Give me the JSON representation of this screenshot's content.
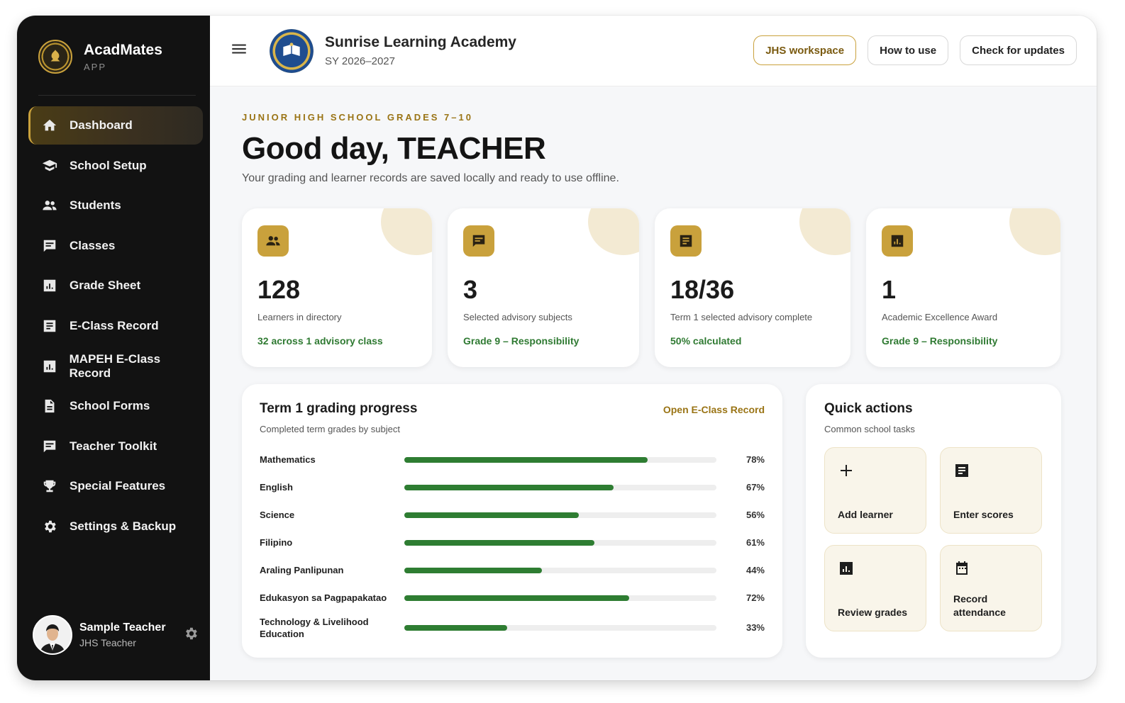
{
  "brand": {
    "name": "AcadMates",
    "sub": "APP"
  },
  "nav": [
    {
      "label": "Dashboard",
      "icon": "home-icon",
      "active": true
    },
    {
      "label": "School Setup",
      "icon": "school-icon"
    },
    {
      "label": "Students",
      "icon": "people-icon"
    },
    {
      "label": "Classes",
      "icon": "chat-icon"
    },
    {
      "label": "Grade Sheet",
      "icon": "chart-icon"
    },
    {
      "label": "E-Class Record",
      "icon": "record-icon"
    },
    {
      "label": "MAPEH E-Class Record",
      "icon": "chart-icon"
    },
    {
      "label": "School Forms",
      "icon": "document-icon"
    },
    {
      "label": "Teacher Toolkit",
      "icon": "chat-icon"
    },
    {
      "label": "Special Features",
      "icon": "trophy-icon"
    },
    {
      "label": "Settings & Backup",
      "icon": "gear-icon"
    }
  ],
  "user": {
    "name": "Sample Teacher",
    "role": "JHS Teacher"
  },
  "header": {
    "school_name": "Sunrise Learning Academy",
    "school_year": "SY 2026–2027",
    "buttons": {
      "workspace": "JHS workspace",
      "how_to": "How to use",
      "updates": "Check for updates"
    }
  },
  "hero": {
    "eyebrow": "JUNIOR HIGH SCHOOL GRADES 7–10",
    "greeting": "Good day, TEACHER",
    "subtitle": "Your grading and learner records are saved locally and ready to use offline."
  },
  "cards": [
    {
      "value": "128",
      "label": "Learners in directory",
      "note": "32 across 1 advisory class",
      "icon": "people-icon"
    },
    {
      "value": "3",
      "label": "Selected advisory subjects",
      "note": "Grade 9 – Responsibility",
      "icon": "chat-icon"
    },
    {
      "value": "18/36",
      "label": "Term 1 selected advisory complete",
      "note": "50% calculated",
      "icon": "record-icon"
    },
    {
      "value": "1",
      "label": "Academic Excellence Award",
      "note": "Grade 9 – Responsibility",
      "icon": "chart-icon"
    }
  ],
  "progress": {
    "title": "Term 1 grading progress",
    "subtitle": "Completed term grades by subject",
    "link": "Open E-Class Record",
    "bar_color": "#2e7d32",
    "rows": [
      {
        "subject": "Mathematics",
        "percent": 78,
        "label": "78%"
      },
      {
        "subject": "English",
        "percent": 67,
        "label": "67%"
      },
      {
        "subject": "Science",
        "percent": 56,
        "label": "56%"
      },
      {
        "subject": "Filipino",
        "percent": 61,
        "label": "61%"
      },
      {
        "subject": "Araling Panlipunan",
        "percent": 44,
        "label": "44%"
      },
      {
        "subject": "Edukasyon sa Pagpapakatao",
        "percent": 72,
        "label": "72%"
      },
      {
        "subject": "Technology & Livelihood Education",
        "percent": 33,
        "label": "33%"
      }
    ]
  },
  "quick_actions": {
    "title": "Quick actions",
    "subtitle": "Common school tasks",
    "items": [
      {
        "label": "Add learner",
        "icon": "plus-icon"
      },
      {
        "label": "Enter scores",
        "icon": "record-icon"
      },
      {
        "label": "Review grades",
        "icon": "chart-icon"
      },
      {
        "label": "Record attendance",
        "icon": "calendar-icon"
      }
    ]
  },
  "colors": {
    "accent_gold": "#c9a13c",
    "sidebar_bg": "#121212",
    "success_green": "#2f7a32"
  }
}
